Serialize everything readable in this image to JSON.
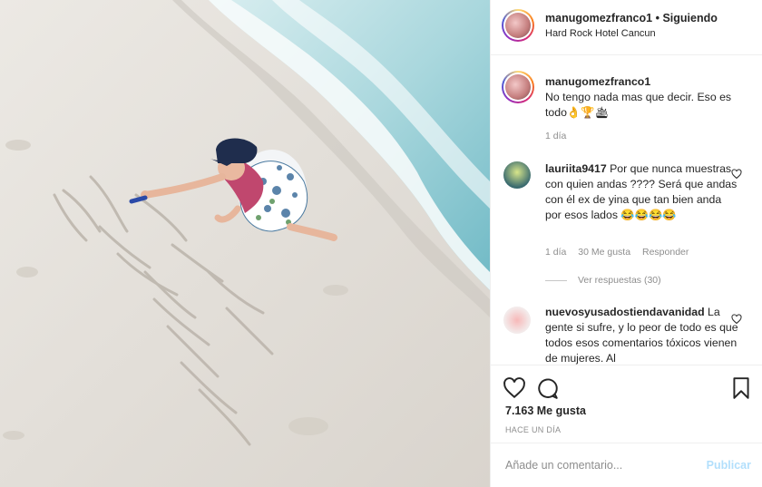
{
  "post": {
    "username": "manugomezfranco1",
    "separator": "•",
    "follow_status": "Siguiendo",
    "location": "Hard Rock Hotel Cancun"
  },
  "caption": {
    "username": "manugomezfranco1",
    "text": "No tengo nada mas que decir. Eso es todo👌🏆🛳",
    "time": "1 día"
  },
  "comments": [
    {
      "username": "lauriita9417",
      "text": "Por que nunca muestras con quien andas ???? Será que andas con él ex de yina que tan bien anda por esos lados 😂😂😂😂",
      "time": "1 día",
      "likes": "30 Me gusta",
      "reply": "Responder",
      "view_replies": "Ver respuestas (30)"
    },
    {
      "username": "nuevosyusadostiendavanidad",
      "text": "La gente si sufre, y lo peor de todo es que todos esos comentarios tóxicos vienen de mujeres. Al"
    }
  ],
  "actions": {
    "likes": "7.163 Me gusta",
    "time": "HACE UN DÍA",
    "icons": [
      "heart-icon",
      "comment-icon",
      "bookmark-icon"
    ]
  },
  "add_comment": {
    "placeholder": "Añade un comentario...",
    "publish": "Publicar"
  },
  "colors": {
    "link_blue_disabled": "#b2dffc",
    "meta_gray": "#8e8e8e",
    "border": "#efefef"
  }
}
